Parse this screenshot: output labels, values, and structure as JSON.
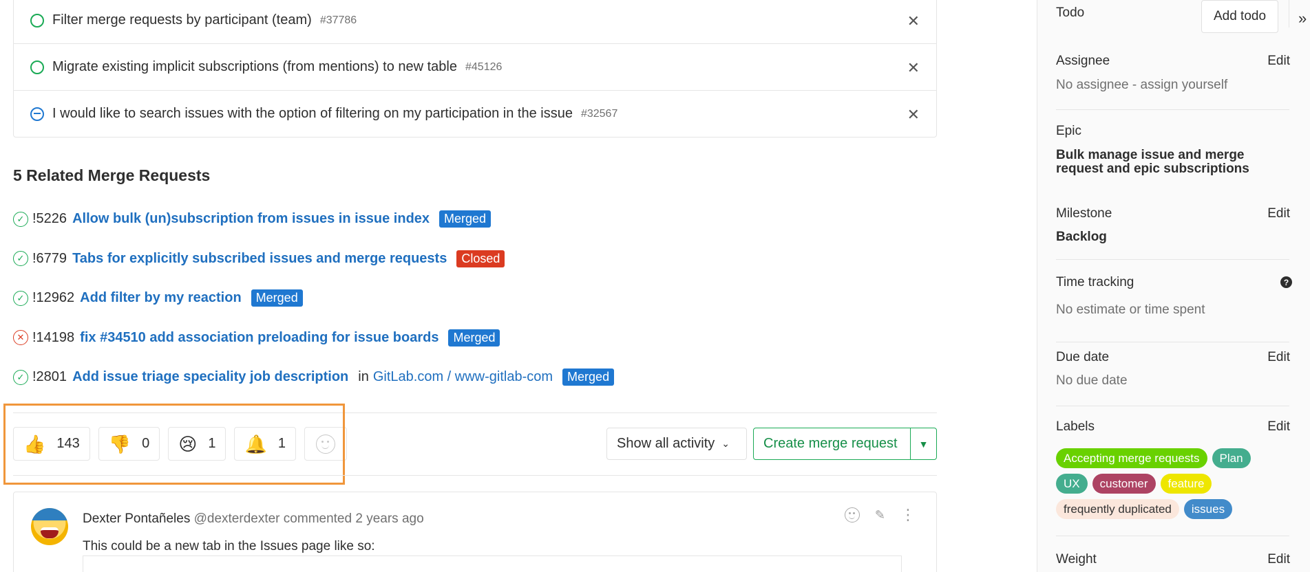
{
  "related_issues": [
    {
      "status": "open",
      "title": "Filter merge requests by participant (team)",
      "ref": "#37786"
    },
    {
      "status": "open",
      "title": "Migrate existing implicit subscriptions (from mentions) to new table",
      "ref": "#45126"
    },
    {
      "status": "blocked",
      "title": "I would like to search issues with the option of filtering on my participation in the issue",
      "ref": "#32567"
    }
  ],
  "merge_requests": {
    "heading": "5 Related Merge Requests",
    "items": [
      {
        "pipeline": "success",
        "ref": "!5226",
        "title": "Allow bulk (un)subscription from issues in issue index",
        "state": "Merged",
        "state_color": "#1f78d1"
      },
      {
        "pipeline": "success",
        "ref": "!6779",
        "title": "Tabs for explicitly subscribed issues and merge requests",
        "state": "Closed",
        "state_color": "#db3b21"
      },
      {
        "pipeline": "success",
        "ref": "!12962",
        "title": "Add filter by my reaction",
        "state": "Merged",
        "state_color": "#1f78d1"
      },
      {
        "pipeline": "failed",
        "ref": "!14198",
        "title": "fix #34510 add association preloading for issue boards",
        "state": "Merged",
        "state_color": "#1f78d1"
      },
      {
        "pipeline": "success",
        "ref": "!2801",
        "title": "Add issue triage speciality job description",
        "in_text": "in",
        "project": "GitLab.com / www-gitlab-com",
        "state": "Merged",
        "state_color": "#1f78d1"
      }
    ]
  },
  "awards": [
    {
      "emoji": "👍",
      "icon": "thumbs-up",
      "count": "143"
    },
    {
      "emoji": "👎",
      "icon": "thumbs-down",
      "count": "0"
    },
    {
      "emoji": "😢",
      "icon": "cry",
      "count": "1"
    },
    {
      "emoji": "🔔",
      "icon": "bell",
      "count": "1"
    }
  ],
  "activity": {
    "filter_label": "Show all activity"
  },
  "create_mr": {
    "label": "Create merge request"
  },
  "note": {
    "author": "Dexter Pontañeles",
    "username": "@dexterdexter",
    "action": "commented",
    "time": "2 years ago",
    "body": "This could be a new tab in the Issues page like so:"
  },
  "sidebar": {
    "todo": {
      "title": "Todo",
      "button": "Add todo",
      "collapse": "»"
    },
    "assignee": {
      "title": "Assignee",
      "edit": "Edit",
      "value": "No assignee - assign yourself"
    },
    "epic": {
      "title": "Epic",
      "value": "Bulk manage issue and merge request and epic subscriptions"
    },
    "milestone": {
      "title": "Milestone",
      "edit": "Edit",
      "value": "Backlog"
    },
    "time_tracking": {
      "title": "Time tracking",
      "value": "No estimate or time spent",
      "help": "?"
    },
    "due_date": {
      "title": "Due date",
      "edit": "Edit",
      "value": "No due date"
    },
    "labels": {
      "title": "Labels",
      "edit": "Edit",
      "items": [
        {
          "text": "Accepting merge requests",
          "bg": "#69d100",
          "fg": "#ffffff"
        },
        {
          "text": "Plan",
          "bg": "#44ad8e",
          "fg": "#ffffff"
        },
        {
          "text": "UX",
          "bg": "#44ad8e",
          "fg": "#ffffff"
        },
        {
          "text": "customer",
          "bg": "#ad4363",
          "fg": "#ffffff"
        },
        {
          "text": "feature",
          "bg": "#eee600",
          "fg": "#ffffff"
        },
        {
          "text": "frequently duplicated",
          "bg": "#fbe7dc",
          "fg": "#333333"
        },
        {
          "text": "issues",
          "bg": "#428bca",
          "fg": "#ffffff"
        }
      ]
    },
    "weight": {
      "title": "Weight",
      "edit": "Edit"
    }
  }
}
